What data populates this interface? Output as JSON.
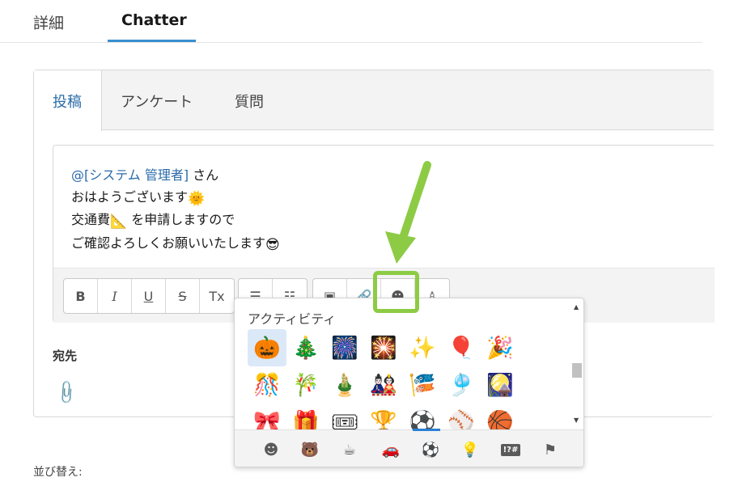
{
  "top_tabs": {
    "details": "詳細",
    "chatter": "Chatter"
  },
  "publisher_tabs": {
    "post": "投稿",
    "poll": "アンケート",
    "question": "質問"
  },
  "editor": {
    "mention": "@[システム 管理者]",
    "line1_suffix": " さん",
    "line2": "おはようございます",
    "line3_a": "交通費",
    "line3_b": " を申請しますので",
    "line4": "ご確認よろしくお願いいたします",
    "emoji_sun": "🌞",
    "emoji_ruler": "📐",
    "emoji_cool": "😎"
  },
  "toolbar": {
    "bold": "B",
    "italic": "I",
    "underline": "U",
    "strike": "S",
    "clear_format": "Tx",
    "bullets": "☰",
    "numbered": "☷",
    "image": "▣",
    "link": "🔗",
    "emoji": "☻",
    "mention": "♙"
  },
  "to_label": "宛先",
  "sort_label": "並び替え:",
  "picker": {
    "category_title": "アクティビティ",
    "rows": [
      [
        "🎃",
        "🎄",
        "🎆",
        "🎇",
        "✨",
        "🎈",
        "🎉"
      ],
      [
        "🎊",
        "🎋",
        "🎍",
        "🎎",
        "🎏",
        "🎐",
        "🎑"
      ],
      [
        "🎀",
        "🎁",
        "🎟",
        "🏆",
        "⚽",
        "⚾",
        "🏀"
      ]
    ],
    "categories": [
      "☻",
      "🐻",
      "☕",
      "🚗",
      "⚽",
      "💡",
      "!?#",
      "⚑"
    ]
  },
  "colors": {
    "accent": "#3a8fd1",
    "highlight": "#8dcb45",
    "link": "#2a6ba8"
  }
}
